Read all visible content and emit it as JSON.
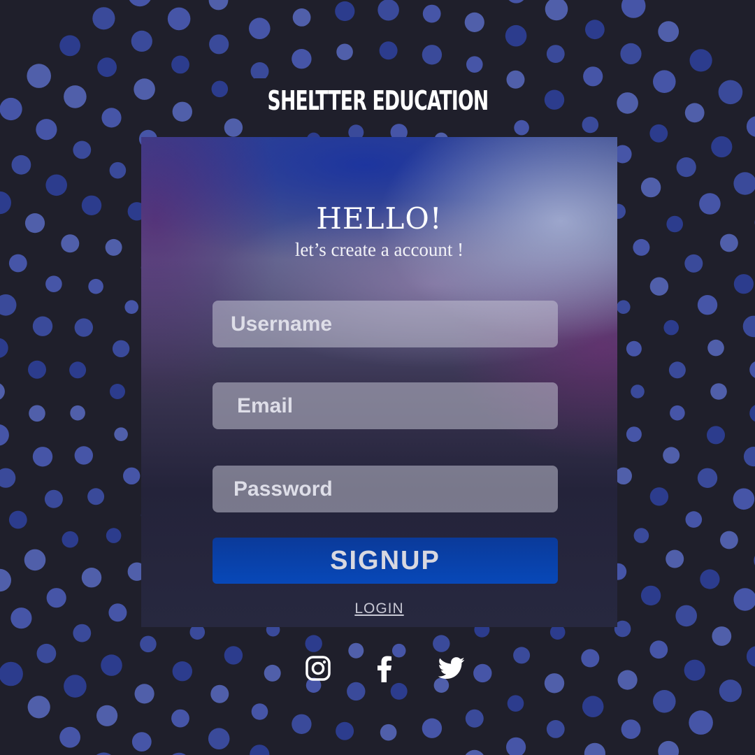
{
  "brand": {
    "title": "SHELTTER EDUCATION"
  },
  "card": {
    "heading": "HELLO!",
    "subheading": "let’s create a account !"
  },
  "form": {
    "username": {
      "placeholder": "Username"
    },
    "email": {
      "placeholder": "Email"
    },
    "password": {
      "placeholder": "Password"
    },
    "signup_label": "SIGNUP",
    "login_label": "LOGIN"
  },
  "social": {
    "icons": [
      "instagram-icon",
      "facebook-icon",
      "twitter-icon"
    ]
  },
  "colors": {
    "background": "#1f1f2b",
    "dot": "#4a5ab8",
    "button": "#0848b8",
    "text": "#ffffff"
  }
}
